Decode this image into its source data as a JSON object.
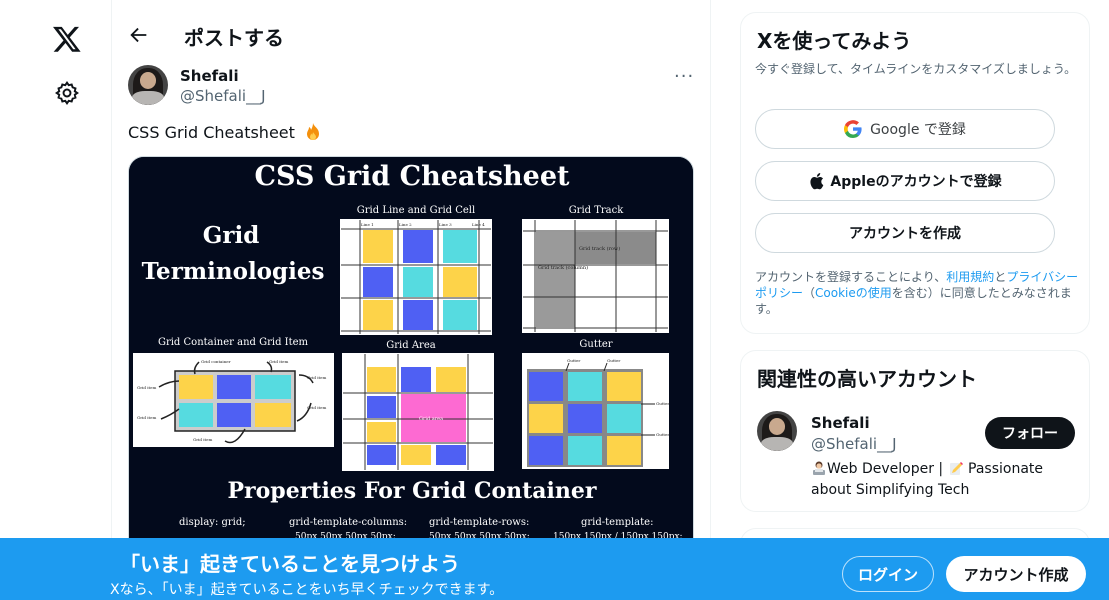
{
  "nav": {
    "logo_icon": "x-logo-icon",
    "settings_icon": "gear-icon"
  },
  "header": {
    "back_icon": "arrow-left-icon",
    "title": "ポストする"
  },
  "tweet": {
    "author_name": "Shefali",
    "author_handle": "@Shefali__J",
    "more_label": "···",
    "text": "CSS Grid Cheatsheet",
    "emoji_icon": "fire-icon"
  },
  "media": {
    "title": "CSS Grid Cheatsheet",
    "terminologies": [
      "Grid",
      "Terminologies"
    ],
    "panels": {
      "line_cell": "Grid Line and Grid Cell",
      "track": "Grid Track",
      "container_item": "Grid Container and Grid Item",
      "area": "Grid Area",
      "gutter": "Gutter"
    },
    "cell_label": "Grid cell",
    "track_label_row": "Grid track (row)",
    "track_label_col": "Grid track (column)",
    "grid_lines": [
      "Line 1",
      "Line 2",
      "Line 3",
      "Line 4"
    ],
    "grid_container_label": "Grid container",
    "grid_item_label": "Grid item",
    "grid_area_label": "Grid area",
    "gutter_label": "Gutter",
    "properties_title": "Properties For Grid  Container",
    "props": [
      "display: grid;",
      "grid-template-columns:",
      "grid-template-rows:",
      "grid-template:"
    ],
    "props_values": [
      "50px 50px 50px 50px;",
      "50px 50px 50px 50px;",
      "150px 150px / 150px 150px;"
    ]
  },
  "sidebar_signup": {
    "title": "Xを使ってみよう",
    "subtitle": "今すぐ登録して、タイムラインをカスタマイズしましょう。",
    "google_label": "Google で登録",
    "apple_label": "Appleのアカウントで登録",
    "create_label": "アカウントを作成",
    "terms_before": "アカウントを登録することにより、",
    "terms_link": "利用規約",
    "terms_and": "と",
    "privacy_link": "プライバシーポリシー",
    "terms_paren_open": "（",
    "cookie_link": "Cookieの使用",
    "terms_after": "を含む）に同意したとみなされます。"
  },
  "sidebar_related": {
    "title": "関連性の高いアカウント",
    "name": "Shefali",
    "handle": "@Shefali__J",
    "bio_part1": "Web Developer | ",
    "bio_part2": " Passionate about Simplifying Tech",
    "follow_label": "フォロー"
  },
  "bottom_bar": {
    "title": "「いま」起きていることを見つけよう",
    "subtitle": "Xなら、「いま」起きていることをいち早くチェックできます。",
    "login_label": "ログイン",
    "signup_label": "アカウント作成"
  },
  "colors": {
    "accent": "#1d9bf0",
    "yellow": "#fdd349",
    "blue": "#4f60f3",
    "cyan": "#56dbe0",
    "pink": "#fd6ad2",
    "navy": "#030a1c"
  }
}
